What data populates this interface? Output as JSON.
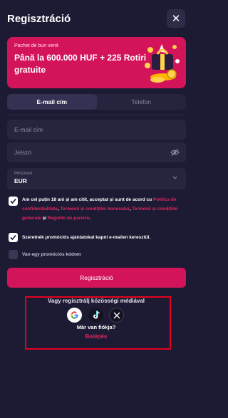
{
  "header": {
    "title": "Regisztráció",
    "close_icon": "close-icon"
  },
  "promo": {
    "small": "Pachet de bun venit",
    "headline": "Până la 600.000 HUF + 225 Rotiri gratuite",
    "art_icon": "gift-box-icon"
  },
  "tabs": [
    {
      "label": "E-mail cím",
      "active": true
    },
    {
      "label": "Telefon",
      "active": false
    }
  ],
  "form": {
    "email_placeholder": "E-mail cím",
    "password_placeholder": "Jelszó",
    "currency_label": "Pénznem",
    "currency_value": "EUR"
  },
  "checks": {
    "terms": {
      "checked": true,
      "t1": "Am cel puțin 18 ani și am citit, acceptat și sunt de acord cu",
      "l1": "Politica de confidențialitate",
      "sep1": ",",
      "l2": "Termenii și condițiile bonusului",
      "sep2": ",",
      "l3": "Termenii și condițiile generale",
      "t2": "și",
      "l4": "Regulile de pariere",
      "t3": "."
    },
    "promo_emails": {
      "checked": true,
      "text": "Szeretnék promóciós ajánlatokat kapni e-mailen keresztül."
    },
    "promo_code": {
      "checked": false,
      "text": "Van egy promóciós kódom"
    }
  },
  "register_button": "Regisztráció",
  "social": {
    "heading": "Vagy regisztrálj közösségi médiával",
    "icons": [
      "google-icon",
      "tiktok-icon",
      "x-icon"
    ]
  },
  "account": {
    "question": "Már van fiókja?",
    "login": "Belépés"
  },
  "colors": {
    "background": "#1d1b34",
    "accent": "#d3145a",
    "highlight": "#e4001e"
  }
}
